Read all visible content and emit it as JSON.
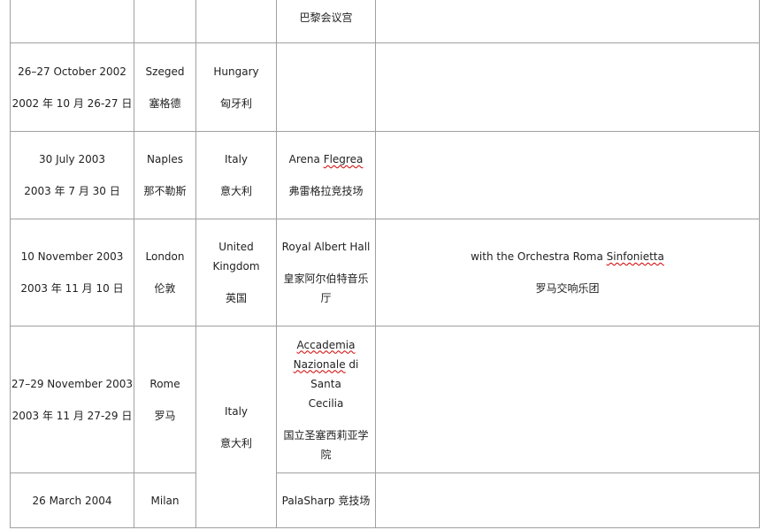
{
  "table": {
    "rows": [
      {
        "date_en": "",
        "date_zh": "",
        "city_en": "",
        "city_zh": "",
        "country_en": "",
        "country_zh": "",
        "venue_en": "",
        "venue_zh": "巴黎会议宫",
        "notes_en": "",
        "notes_zh": ""
      },
      {
        "date_en": "26–27 October 2002",
        "date_zh": "2002 年 10 月 26-27 日",
        "city_en": "Szeged",
        "city_zh": "塞格德",
        "country_en": "Hungary",
        "country_zh": "匈牙利",
        "venue_en": "",
        "venue_zh": "",
        "notes_en": "",
        "notes_zh": ""
      },
      {
        "date_en": "30 July 2003",
        "date_zh": "2003 年 7 月 30 日",
        "city_en": "Naples",
        "city_zh": "那不勒斯",
        "country_en": "Italy",
        "country_zh": "意大利",
        "venue_en_a": "Arena ",
        "venue_en_b": "Flegrea",
        "venue_zh": "弗雷格拉竞技场",
        "notes_en": "",
        "notes_zh": ""
      },
      {
        "date_en": "10 November 2003",
        "date_zh": "2003 年 11 月 10 日",
        "city_en": "London",
        "city_zh": "伦敦",
        "country_en_1": "United",
        "country_en_2": "Kingdom",
        "country_zh": "英国",
        "venue_en": "Royal Albert Hall",
        "venue_zh_1": "皇家阿尔伯特音乐",
        "venue_zh_2": "厅",
        "notes_en_a": "with the Orchestra Roma ",
        "notes_en_b": "Sinfonietta",
        "notes_zh": "罗马交响乐团"
      },
      {
        "date_en": "27–29 November 2003",
        "date_zh": "2003 年 11 月 27-29 日",
        "city_en": "Rome",
        "city_zh": "罗马",
        "country_en": "Italy",
        "country_zh": "意大利",
        "venue_en_1": "Accademia",
        "venue_en_2a": "Nazionale",
        "venue_en_2b": " di Santa",
        "venue_en_3": "Cecilia",
        "venue_zh_1": "国立圣塞西莉亚学",
        "venue_zh_2": "院",
        "notes_en": "",
        "notes_zh": ""
      },
      {
        "date_en": "26 March 2004",
        "city_en": "Milan",
        "venue_en": "PalaSharp 竞技场"
      }
    ]
  }
}
